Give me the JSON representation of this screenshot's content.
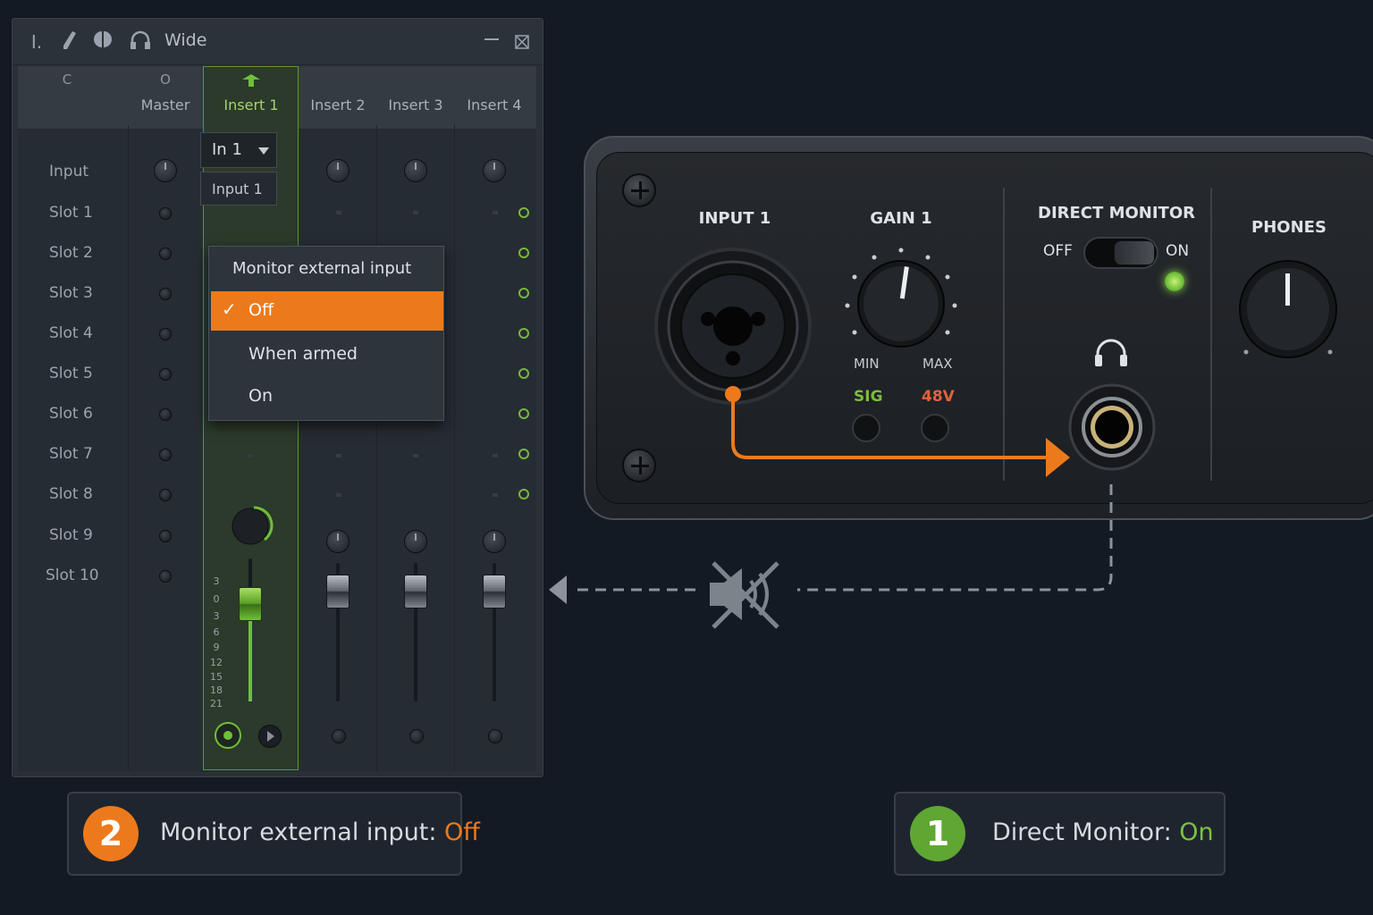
{
  "window": {
    "title": "Wide",
    "icons": [
      "cursor-icon",
      "pencil-icon",
      "stereo-icon",
      "headphone-icon",
      "minimize-icon",
      "close-icon"
    ]
  },
  "mixer": {
    "columns": [
      {
        "top": "C",
        "label": ""
      },
      {
        "top": "O",
        "label": "Master"
      },
      {
        "top": "",
        "label": "Insert 1"
      },
      {
        "top": "",
        "label": "Insert 2"
      },
      {
        "top": "",
        "label": "Insert 3"
      },
      {
        "top": "",
        "label": "Insert 4"
      }
    ],
    "row_labels": [
      "Input",
      "Slot 1",
      "Slot 2",
      "Slot 3",
      "Slot 4",
      "Slot 5",
      "Slot 6",
      "Slot 7",
      "Slot 8",
      "Slot 9",
      "Slot 10"
    ],
    "input_select": "In 1",
    "input_name": "Input 1",
    "meter_scale": [
      "3",
      "0",
      "3",
      "6",
      "9",
      "12",
      "15",
      "18",
      "21"
    ],
    "accent_color": "#78b83a"
  },
  "popup": {
    "title": "Monitor external input",
    "options": [
      "Off",
      "When armed",
      "On"
    ],
    "selected": "Off",
    "check": "✓",
    "highlight_color": "#ec7a1c"
  },
  "device": {
    "input_label": "INPUT 1",
    "gain_label": "GAIN 1",
    "gain_min": "MIN",
    "gain_max": "MAX",
    "sig_label": "SIG",
    "phantom_label": "48V",
    "direct_monitor_label": "DIRECT MONITOR",
    "switch_off": "OFF",
    "switch_on": "ON",
    "phones_label": "PHONES"
  },
  "badges": [
    {
      "number": "2",
      "text": "Monitor external input: ",
      "value": "Off",
      "color": "#ec7a1c"
    },
    {
      "number": "1",
      "text": "Direct Monitor: ",
      "value": "On",
      "color": "#5fa732"
    }
  ]
}
